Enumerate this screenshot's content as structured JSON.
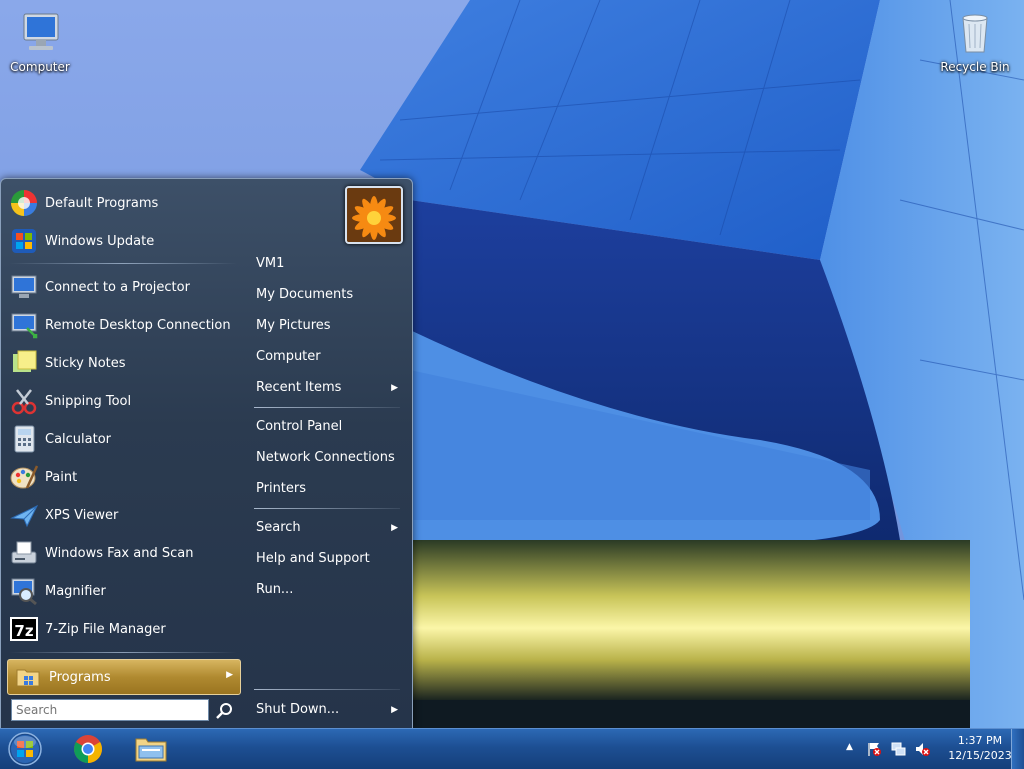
{
  "desktop": {
    "icons": [
      {
        "label": "Computer",
        "icon": "computer-icon"
      },
      {
        "label": "Recycle Bin",
        "icon": "recycle-bin-icon"
      }
    ]
  },
  "start_menu": {
    "pinned": [
      {
        "label": "Default Programs",
        "icon": "default-programs-icon"
      },
      {
        "label": "Windows Update",
        "icon": "windows-update-icon"
      }
    ],
    "recent": [
      {
        "label": "Connect to a Projector",
        "icon": "projector-icon"
      },
      {
        "label": "Remote Desktop Connection",
        "icon": "remote-desktop-icon"
      },
      {
        "label": "Sticky Notes",
        "icon": "sticky-notes-icon"
      },
      {
        "label": "Snipping Tool",
        "icon": "snipping-tool-icon"
      },
      {
        "label": "Calculator",
        "icon": "calculator-icon"
      },
      {
        "label": "Paint",
        "icon": "paint-icon"
      },
      {
        "label": "XPS Viewer",
        "icon": "xps-viewer-icon"
      },
      {
        "label": "Windows Fax and Scan",
        "icon": "fax-scan-icon"
      },
      {
        "label": "Magnifier",
        "icon": "magnifier-icon"
      },
      {
        "label": "7-Zip File Manager",
        "icon": "7zip-icon",
        "glyph": "7z"
      }
    ],
    "programs_label": "Programs",
    "search_placeholder": "Search",
    "right": {
      "group1": [
        "VM1",
        "My Documents",
        "My Pictures",
        "Computer"
      ],
      "recent_items": "Recent Items",
      "group2": [
        "Control Panel",
        "Network Connections",
        "Printers"
      ],
      "search": "Search",
      "group3": [
        "Help and Support",
        "Run..."
      ],
      "shutdown": "Shut Down..."
    }
  },
  "taskbar": {
    "pinned": [
      "chrome-icon",
      "file-explorer-icon"
    ],
    "tray_icons": [
      "show-hidden-icons-icon",
      "action-center-flag-icon",
      "network-icon",
      "volume-muted-icon"
    ],
    "clock": {
      "time": "1:37 PM",
      "date": "12/15/2023"
    }
  }
}
